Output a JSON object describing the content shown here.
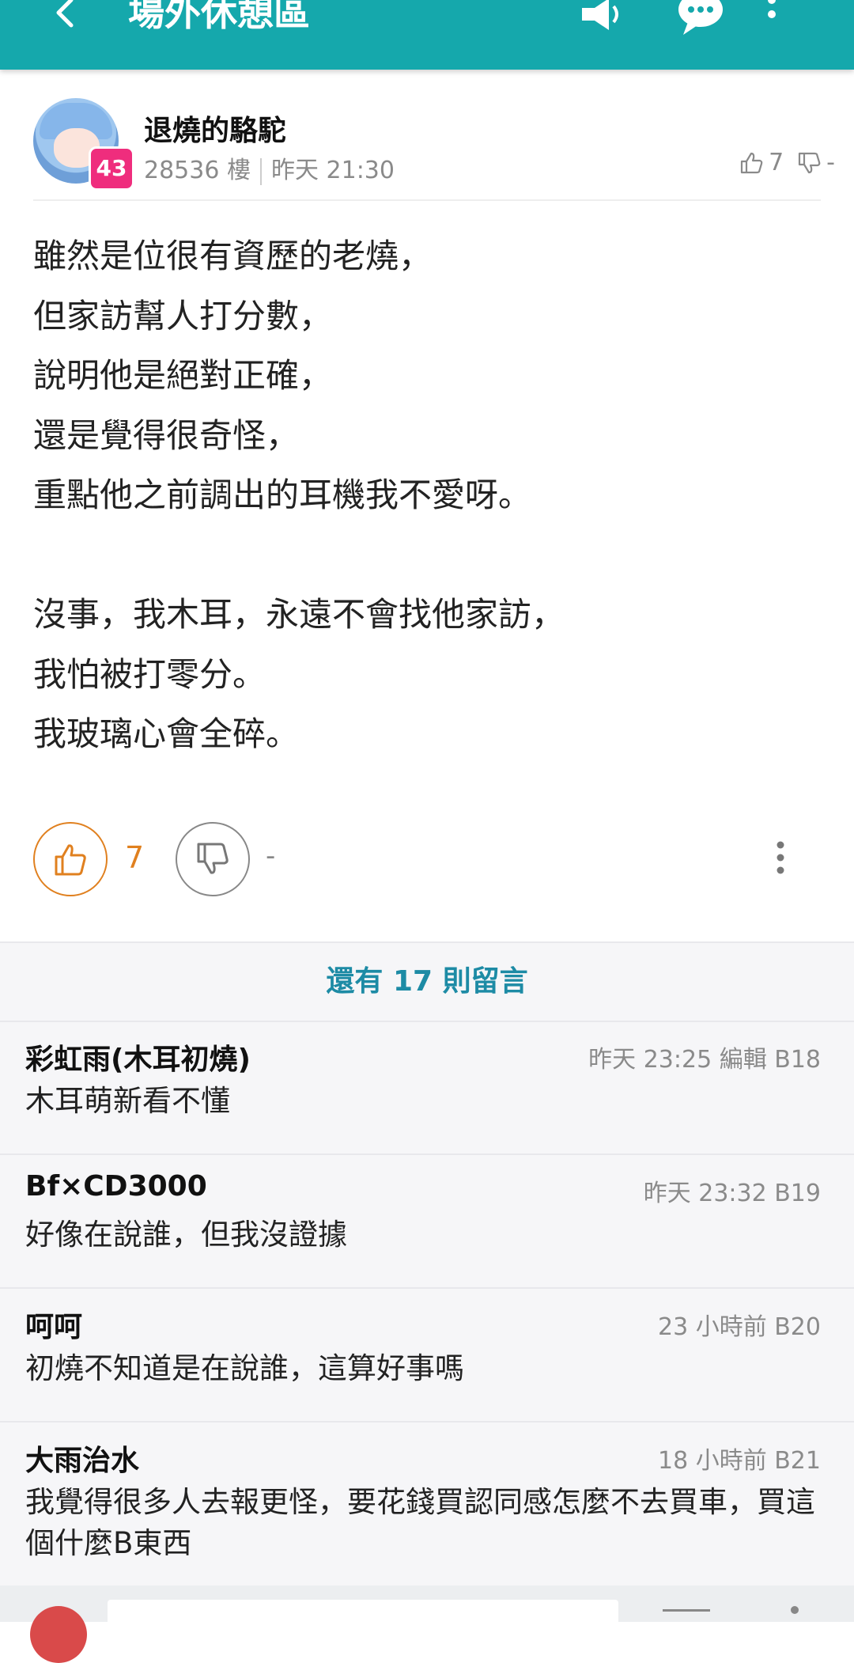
{
  "app": {
    "title": "場外休憩區"
  },
  "post": {
    "author": "退燒的駱駝",
    "level": "43",
    "floor": "28536 樓",
    "time": "昨天 21:30",
    "mini_up_count": "7",
    "mini_down_count": "-",
    "content_lines": [
      "雖然是位很有資歷的老燒，",
      "但家訪幫人打分數，",
      "說明他是絕對正確，",
      "還是覺得很奇怪，",
      "重點他之前調出的耳機我不愛呀。",
      "",
      "沒事，我木耳，永遠不會找他家訪，",
      "我怕被打零分。",
      "我玻璃心會全碎。"
    ],
    "up_count": "7",
    "down_count": "-"
  },
  "more_comments_label": "還有 17 則留言",
  "comments": [
    {
      "name": "彩虹雨(木耳初燒)",
      "meta": "昨天 23:25 編輯   B18",
      "text": "木耳萌新看不懂"
    },
    {
      "name": "Bf×CD3000",
      "meta": "昨天 23:32   B19",
      "text": "好像在說誰，但我沒證據"
    },
    {
      "name": "呵呵",
      "meta": "23 小時前   B20",
      "text": "初燒不知道是在說誰，這算好事嗎"
    },
    {
      "name": "大雨治水",
      "meta": "18 小時前   B21",
      "text": "我覺得很多人去報更怪，要花錢買認同感怎麼不去買車，買這個什麼B東西"
    }
  ],
  "colors": {
    "topbar": "#15a8ac",
    "like": "#e0801f",
    "link": "#1d8ba5",
    "level_badge": "#ef2d7d"
  },
  "icons": [
    "back-arrow-icon",
    "megaphone-icon",
    "chat-bubble-icon",
    "more-vertical-icon",
    "thumb-up-icon",
    "thumb-down-icon"
  ]
}
